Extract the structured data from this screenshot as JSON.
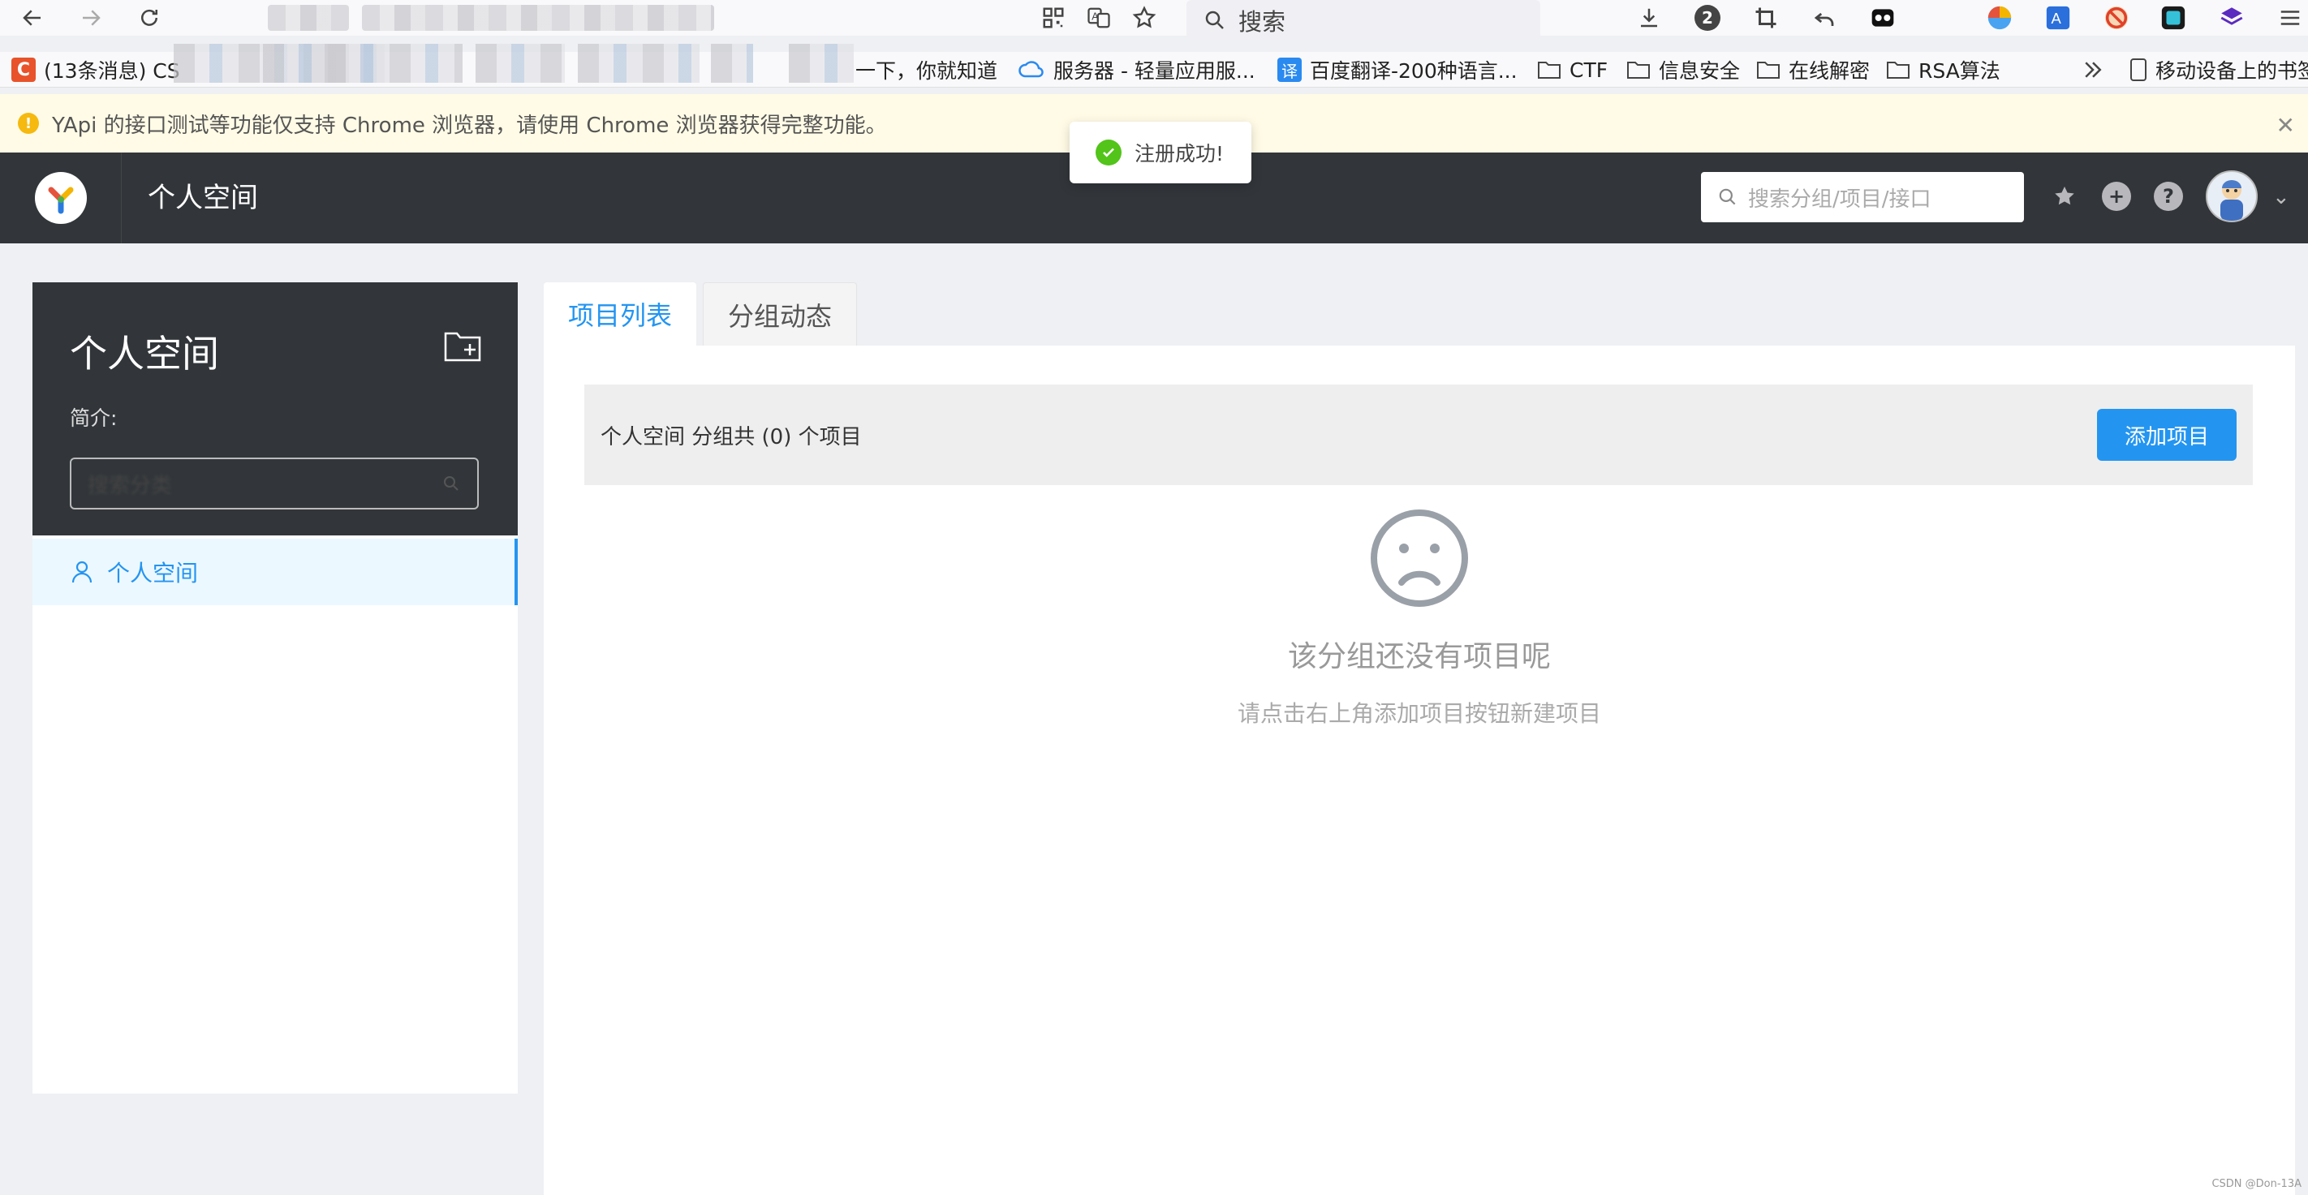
{
  "browser": {
    "search_label": "搜索",
    "badge_count": "2",
    "bookmarks": [
      {
        "label": "(13条消息) CS"
      },
      {
        "label": "一下，你就知道"
      },
      {
        "label": "服务器 - 轻量应用服..."
      },
      {
        "label": "百度翻译-200种语言..."
      },
      {
        "label": "CTF"
      },
      {
        "label": "信息安全"
      },
      {
        "label": "在线解密"
      },
      {
        "label": "RSA算法"
      },
      {
        "label": "移动设备上的书签"
      }
    ]
  },
  "warning": {
    "text": "YApi 的接口测试等功能仅支持 Chrome 浏览器，请使用 Chrome 浏览器获得完整功能。"
  },
  "toast": {
    "text": "注册成功!"
  },
  "header": {
    "title": "个人空间",
    "search_placeholder": "搜索分组/项目/接口"
  },
  "sidebar": {
    "title": "个人空间",
    "intro_label": "简介:",
    "search_placeholder": "搜索分类",
    "items": [
      {
        "label": "个人空间"
      }
    ]
  },
  "tabs": [
    {
      "label": "项目列表",
      "active": true
    },
    {
      "label": "分组动态",
      "active": false
    }
  ],
  "main": {
    "summary": "个人空间 分组共 (0) 个项目",
    "add_button": "添加项目",
    "empty_title": "该分组还没有项目呢",
    "empty_desc": "请点击右上角添加项目按钮新建项目"
  },
  "watermark": "CSDN @Don-13A",
  "colors": {
    "accent": "#2395f1",
    "header_bg": "#32363a",
    "warning_bg": "#fffbe6",
    "success": "#52c41a"
  }
}
